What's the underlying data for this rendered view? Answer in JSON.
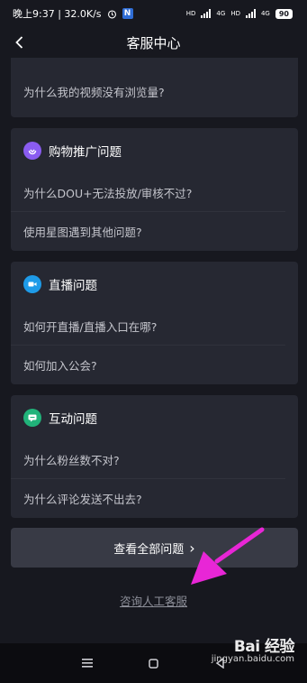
{
  "status_bar": {
    "time_speed": "晚上9:37 | 32.0K/s",
    "net_tag_1": "HD",
    "net_tag_2": "4G",
    "net_tag_3": "HD",
    "net_tag_4": "4G",
    "battery": "90"
  },
  "header": {
    "title": "客服中心"
  },
  "cards": [
    {
      "title": "",
      "questions": [
        "为什么我的视频没有浏览量?"
      ]
    },
    {
      "title": "购物推广问题",
      "icon": "shopping-icon",
      "icon_color": "#8a5cf0",
      "questions": [
        "为什么DOU+无法投放/审核不过?",
        "使用星图遇到其他问题?"
      ]
    },
    {
      "title": "直播问题",
      "icon": "live-camera-icon",
      "icon_color": "#1e9be8",
      "questions": [
        "如何开直播/直播入口在哪?",
        "如何加入公会?"
      ]
    },
    {
      "title": "互动问题",
      "icon": "chat-icon",
      "icon_color": "#21b37a",
      "questions": [
        "为什么粉丝数不对?",
        "为什么评论发送不出去?"
      ]
    }
  ],
  "view_all": {
    "label": "查看全部问题",
    "arrow": "›"
  },
  "contact": {
    "label": "咨询人工客服"
  },
  "annotation_color": "#e826d6",
  "watermark": {
    "main": "Bai 经验",
    "sub": "jingyan.baidu.com"
  }
}
